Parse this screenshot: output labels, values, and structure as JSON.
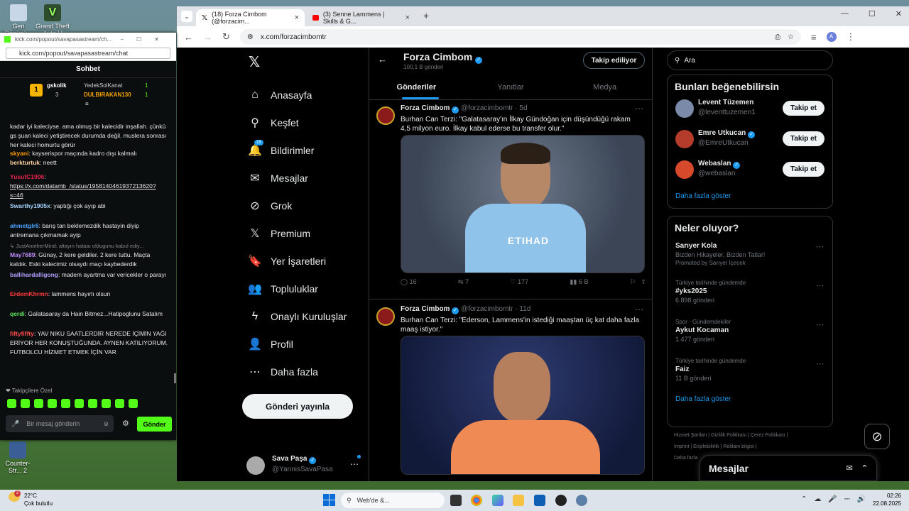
{
  "desktop": {
    "icons": [
      {
        "label": "Geri Dönüşü...",
        "color": "#3b7fc4"
      },
      {
        "label": "Grand Theft Auto V En...",
        "color": "#2d4d2d"
      },
      {
        "label": "Counter-Str... 2",
        "color": "#3b5e96"
      }
    ]
  },
  "browser": {
    "tabs": [
      {
        "label": "(18) Forza Cimbom (@forzacim...",
        "icon": "x-icon",
        "active": true
      },
      {
        "label": "(3) Senne Lammens | Skills & G...",
        "icon": "youtube-icon",
        "active": false
      }
    ],
    "url": "x.com/forzacimbomtr",
    "profile_letter": "A"
  },
  "x": {
    "nav": [
      {
        "label": "Anasayfa",
        "icon": "home-icon",
        "glyph": "⌂"
      },
      {
        "label": "Keşfet",
        "icon": "search-icon",
        "glyph": "⚲"
      },
      {
        "label": "Bildirimler",
        "icon": "bell-icon",
        "glyph": "🔔",
        "badge": "18"
      },
      {
        "label": "Mesajlar",
        "icon": "mail-icon",
        "glyph": "✉"
      },
      {
        "label": "Grok",
        "icon": "grok-icon",
        "glyph": "⊘"
      },
      {
        "label": "Premium",
        "icon": "x-logo-icon",
        "glyph": "𝕏"
      },
      {
        "label": "Yer İşaretleri",
        "icon": "bookmark-icon",
        "glyph": "🔖"
      },
      {
        "label": "Topluluklar",
        "icon": "communities-icon",
        "glyph": "👥"
      },
      {
        "label": "Onaylı Kuruluşlar",
        "icon": "lightning-icon",
        "glyph": "ϟ"
      },
      {
        "label": "Profil",
        "icon": "profile-icon",
        "glyph": "👤"
      },
      {
        "label": "Daha fazla",
        "icon": "more-icon",
        "glyph": "⋯"
      }
    ],
    "post_button": "Gönderi yayınla",
    "me": {
      "name": "Sava Paşa",
      "handle": "@YannisSavaPasa"
    },
    "profile": {
      "name": "Forza Cimbom",
      "count": "100,1 B gönderi",
      "follow_state": "Takip ediliyor",
      "tabs": [
        "Gönderiler",
        "Yanıtlar",
        "Medya"
      ]
    },
    "tweets": [
      {
        "name": "Forza Cimbom",
        "handle": "@forzacimbomtr",
        "time": "· 5d",
        "text": "Burhan Can Terzi: \"Galatasaray'ın İlkay Gündoğan için düşündüğü rakam 4,5 milyon euro. İlkay kabul ederse bu transfer olur.\"",
        "replies": "16",
        "reposts": "7",
        "likes": "177",
        "views": "6 B",
        "image_bg": "#5a6b82",
        "shirt": "#8fc3ea"
      },
      {
        "name": "Forza Cimbom",
        "handle": "@forzacimbomtr",
        "time": "· 11d",
        "text": "Burhan Can Terzi: \"Ederson, Lammens'in istediği maaştan üç kat daha fazla maaş istiyor.\"",
        "image_bg": "#2a3a6b",
        "shirt": "#f08a55"
      }
    ],
    "search_placeholder": "Ara",
    "suggest": {
      "title": "Bunları beğenebilirsin",
      "people": [
        {
          "name": "Levent Tüzemen",
          "handle": "@leventtuzemen1",
          "verified": false,
          "btn": "Takip et",
          "color": "#7a8aa8"
        },
        {
          "name": "Emre Utkucan",
          "handle": "@EmreUtkucan",
          "verified": true,
          "btn": "Takip et",
          "color": "#b53b2a"
        },
        {
          "name": "Webaslan",
          "handle": "@webaslan",
          "verified": true,
          "btn": "Takip et",
          "color": "#d6492a"
        }
      ],
      "more": "Daha fazla göster"
    },
    "trends": {
      "title": "Neler oluyor?",
      "items": [
        {
          "cat": "",
          "title": "Sarıyer Kola",
          "sub": "Bizden Hikayeler, Bizden Tatlar!",
          "sub2": "Promoted by Sarıyer İçecek"
        },
        {
          "cat": "Türkiye tarihinde gündemde",
          "title": "#yks2025",
          "sub": "6.898 gönderi"
        },
        {
          "cat": "Spor · Gündemdekiler",
          "title": "Aykut Kocaman",
          "sub": "1.477 gönderi"
        },
        {
          "cat": "Türkiye tarihinde gündemde",
          "title": "Faiz",
          "sub": "11 B gönderi"
        }
      ],
      "more": "Daha fazla göster"
    },
    "footer": [
      "Hizmet Şartları",
      "Gizlilik Politikası",
      "Çerez Politikası",
      "Imprint",
      "Erişilebilirlik",
      "Reklam bilgisi",
      "Daha fazla"
    ],
    "messages_label": "Mesajlar"
  },
  "kick": {
    "window_title": "kick.com/popout/savapasastream/ch...",
    "url": "kick.com/popout/savapasastream/chat",
    "header": "Sohbet",
    "leaderboard": [
      {
        "rank": "1",
        "name": "gskolik",
        "count": "3"
      },
      {
        "name": "YedekSolKanat",
        "count": "1"
      },
      {
        "name": "DULBIRAKAN130",
        "count": "1"
      }
    ],
    "messages": [
      {
        "user": "",
        "color": "#ffffff",
        "text": "kadar iyi kaleciyse. ama olmuş bir kalecidir inşallah. çünkü gs şuan kaleci yetiştirecek durumda değil. muslera sonrası her kaleci homurtu görür"
      },
      {
        "user": "skyani",
        "color": "#ff9d00",
        "text": ": kayserispor maçında kadro dışı kalmalı"
      },
      {
        "user": "berkturtuk",
        "color": "#ffd2a0",
        "text": ": neett"
      },
      {
        "user": "YusufC1906",
        "color": "#e0244b",
        "text": ":"
      },
      {
        "user": "",
        "color": "#ffffff",
        "text": "https://x.com/datamb_/status/1958140461937213620?s=46"
      },
      {
        "user": "Swarthy1905x",
        "color": "#a3d3ff",
        "text": ": yaptığı çok ayıp abi"
      },
      {
        "user": "ahmetglr6",
        "color": "#4aa3ff",
        "text": ": barış tan beklemezdik hastayin diyip antremana çıkmamak ayip"
      },
      {
        "user": "",
        "color": "#888888",
        "text": "↳ JustAnotherMind: altayın hataaı oldugunu kabul ediy..."
      },
      {
        "user": "May7689",
        "color": "#c08bff",
        "text": ": Günay, 2 kere geldiler. 2 kere tuttu. Maçta kaldık. Eski kalecimiz olsaydı maçı kaybederdik"
      },
      {
        "user": "ballihardalligong",
        "color": "#b4a0ff",
        "text": ": madem ayartma var vericekler o parayı"
      },
      {
        "user": "ErdemKhrmn",
        "color": "#ff3b3b",
        "text": ": lammens hayırlı olsun"
      },
      {
        "user": "qerdi",
        "color": "#5ee45e",
        "text": ": Galatasaray da Hain Bitmez...Hatipoglunu Satalım"
      },
      {
        "user": "fiftyfiffty",
        "color": "#ff4d4d",
        "text": ": YAV NIKU SAATLERDİR NEREDE İÇİMİN YAĞI ERİYOR HER KONUŞTUĞUNDA. AYNEN KATILIYORUM. FUTBOLCU HİZMET ETMEK İÇİN VAR"
      }
    ],
    "followers_only": "❤ Takipçilere Özel",
    "input_placeholder": "Bir mesaj gönderin",
    "send": "Gönder"
  },
  "taskbar": {
    "weather_temp": "22°C",
    "weather_desc": "Çok bulutlu",
    "weather_badge": "2",
    "search_placeholder": "Web'de &...",
    "time": "02:26",
    "date": "22.08.2025"
  }
}
